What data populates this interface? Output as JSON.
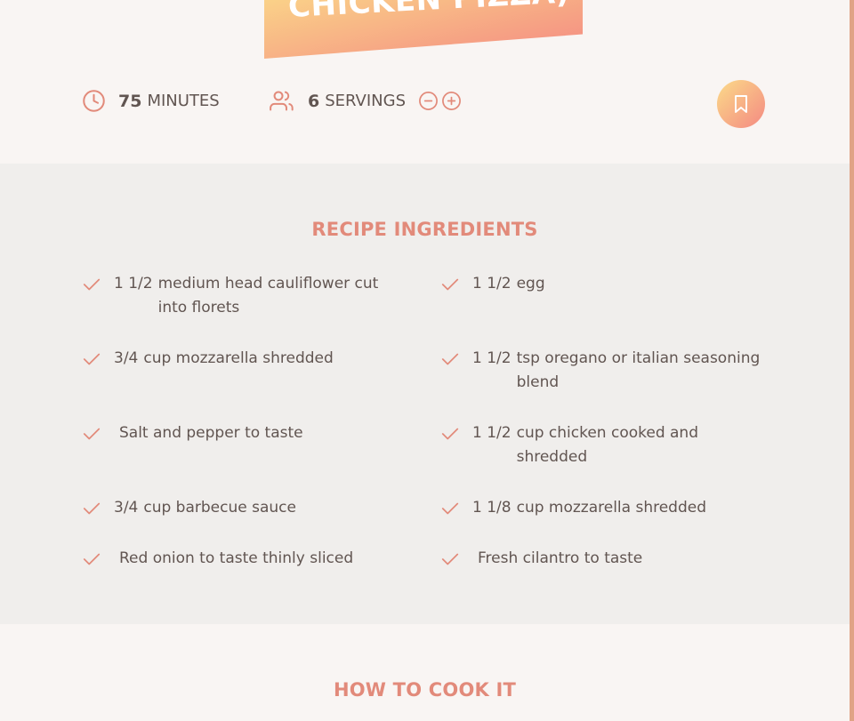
{
  "recipe": {
    "title": "CHICKEN PIZZA)",
    "time": {
      "value": "75",
      "unit": "MINUTES"
    },
    "servings": {
      "value": "6",
      "unit": "SERVINGS"
    }
  },
  "ingredients_heading": "RECIPE INGREDIENTS",
  "ingredients": [
    {
      "qty": "1 1/2",
      "desc": "medium head cauliflower cut into florets"
    },
    {
      "qty": "1 1/2",
      "desc": "egg"
    },
    {
      "qty": "3/4",
      "desc": "cup mozzarella shredded"
    },
    {
      "qty": "1 1/2",
      "desc": "tsp oregano or italian seasoning blend"
    },
    {
      "qty": "",
      "desc": "Salt and pepper to taste"
    },
    {
      "qty": "1 1/2",
      "desc": "cup chicken cooked and shredded"
    },
    {
      "qty": "3/4",
      "desc": "cup barbecue sauce"
    },
    {
      "qty": "1 1/8",
      "desc": "cup mozzarella shredded"
    },
    {
      "qty": "",
      "desc": "Red onion to taste thinly sliced"
    },
    {
      "qty": "",
      "desc": "Fresh cilantro to taste"
    }
  ],
  "how_to_cook_heading": "HOW TO COOK IT",
  "colors": {
    "accent": "#e28a7a",
    "gradient_start": "#fbdb89",
    "gradient_end": "#f48982",
    "text": "#615551",
    "section_bg": "#f0eeec",
    "page_bg": "#f9f5f3"
  },
  "icons": {
    "time": "clock-icon",
    "servings": "users-icon",
    "decrease": "minus-circle-icon",
    "increase": "plus-circle-icon",
    "bookmark": "bookmark-icon",
    "ingredient": "check-icon"
  }
}
